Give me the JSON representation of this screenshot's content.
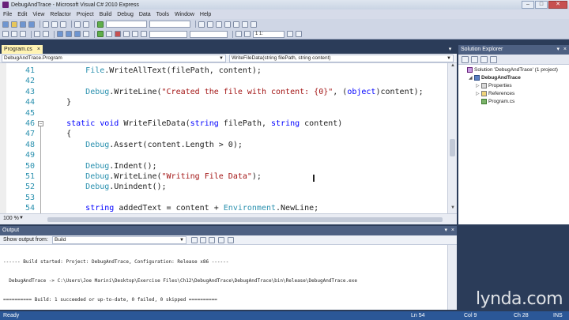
{
  "window": {
    "title": "DebugAndTrace - Microsoft Visual C# 2010 Express",
    "min": "–",
    "max": "□",
    "close": "✕"
  },
  "menu": [
    "File",
    "Edit",
    "View",
    "Refactor",
    "Project",
    "Build",
    "Debug",
    "Data",
    "Tools",
    "Window",
    "Help"
  ],
  "toolbar": {
    "line_combo": "1 1:"
  },
  "editor": {
    "tab_label": "Program.cs",
    "tab_close": "×",
    "class_combo": "DebugAndTrace.Program",
    "member_combo": "WriteFileData(string filePath, string content)",
    "zoom": "100 %",
    "lines": [
      {
        "n": "41",
        "indent": "        ",
        "parts": [
          [
            "t",
            "File"
          ],
          [
            "p",
            ".WriteAllText(filePath, content);"
          ]
        ]
      },
      {
        "n": "42",
        "indent": "",
        "parts": []
      },
      {
        "n": "43",
        "indent": "        ",
        "parts": [
          [
            "t",
            "Debug"
          ],
          [
            "p",
            ".WriteLine("
          ],
          [
            "s",
            "\"Created the file with content: {0}\""
          ],
          [
            "p",
            ", ("
          ],
          [
            "k",
            "object"
          ],
          [
            "p",
            ")content);"
          ]
        ]
      },
      {
        "n": "44",
        "indent": "    ",
        "parts": [
          [
            "p",
            "}"
          ]
        ]
      },
      {
        "n": "45",
        "indent": "",
        "parts": []
      },
      {
        "n": "46",
        "indent": "    ",
        "fold": true,
        "parts": [
          [
            "k",
            "static"
          ],
          [
            "p",
            " "
          ],
          [
            "k",
            "void"
          ],
          [
            "p",
            " WriteFileData("
          ],
          [
            "k",
            "string"
          ],
          [
            "p",
            " filePath, "
          ],
          [
            "k",
            "string"
          ],
          [
            "p",
            " content)"
          ]
        ]
      },
      {
        "n": "47",
        "indent": "    ",
        "parts": [
          [
            "p",
            "{"
          ]
        ]
      },
      {
        "n": "48",
        "indent": "        ",
        "parts": [
          [
            "t",
            "Debug"
          ],
          [
            "p",
            ".Assert(content.Length > 0);"
          ]
        ]
      },
      {
        "n": "49",
        "indent": "",
        "parts": []
      },
      {
        "n": "50",
        "indent": "        ",
        "parts": [
          [
            "t",
            "Debug"
          ],
          [
            "p",
            ".Indent();"
          ]
        ]
      },
      {
        "n": "51",
        "indent": "        ",
        "parts": [
          [
            "t",
            "Debug"
          ],
          [
            "p",
            ".WriteLine("
          ],
          [
            "s",
            "\"Writing File Data\""
          ],
          [
            "p",
            ");"
          ]
        ]
      },
      {
        "n": "52",
        "indent": "        ",
        "parts": [
          [
            "t",
            "Debug"
          ],
          [
            "p",
            ".Unindent();"
          ]
        ]
      },
      {
        "n": "53",
        "indent": "",
        "parts": []
      },
      {
        "n": "54",
        "indent": "        ",
        "parts": [
          [
            "k",
            "string"
          ],
          [
            "p",
            " addedText = content + "
          ],
          [
            "t",
            "Environment"
          ],
          [
            "p",
            ".NewLine;"
          ]
        ]
      }
    ]
  },
  "solution_explorer": {
    "title": "Solution Explorer",
    "pin": "▾",
    "close": "×",
    "items": [
      {
        "label": "Solution 'DebugAndTrace' (1 project)",
        "icon": "sol",
        "depth": 0,
        "tri": ""
      },
      {
        "label": "DebugAndTrace",
        "icon": "proj",
        "depth": 1,
        "tri": "◢",
        "bold": true
      },
      {
        "label": "Properties",
        "icon": "props",
        "depth": 2,
        "tri": "▷"
      },
      {
        "label": "References",
        "icon": "refs",
        "depth": 2,
        "tri": "▷"
      },
      {
        "label": "Program.cs",
        "icon": "cs",
        "depth": 2,
        "tri": ""
      }
    ]
  },
  "output": {
    "title": "Output",
    "pin": "▾",
    "close": "×",
    "show_label": "Show output from:",
    "source": "Build",
    "lines": [
      "------ Build started: Project: DebugAndTrace, Configuration: Release x86 ------",
      "  DebugAndTrace -> C:\\Users\\Joe Marini\\Desktop\\Exercise Files\\Ch12\\DebugAndTrace\\DebugAndTrace\\bin\\Release\\DebugAndTrace.exe",
      "========== Build: 1 succeeded or up-to-date, 0 failed, 0 skipped =========="
    ]
  },
  "status": {
    "ready": "Ready",
    "ln": "Ln 54",
    "col": "Col 9",
    "ch": "Ch 28",
    "ins": "INS"
  },
  "watermark": "lynda.com",
  "colors": {
    "keyword": "#0000ff",
    "string": "#a31515",
    "type": "#2b91af",
    "line_number": "#2b91af",
    "chrome": "#2b3c59"
  }
}
